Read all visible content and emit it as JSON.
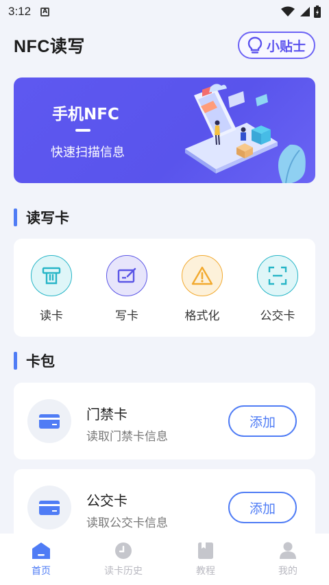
{
  "status_bar": {
    "time": "3:12"
  },
  "header": {
    "title": "NFC读写",
    "tips_label": "小贴士"
  },
  "banner": {
    "title": "手机NFC",
    "subtitle": "快速扫描信息"
  },
  "sections": {
    "read_write": "读写卡",
    "wallet": "卡包"
  },
  "tools": [
    {
      "label": "读卡",
      "icon": "card-reader-icon",
      "color": "#26b5c7",
      "bg": "#dff6f8"
    },
    {
      "label": "写卡",
      "icon": "write-card-icon",
      "color": "#5a55e6",
      "bg": "#e7e5fb"
    },
    {
      "label": "格式化",
      "icon": "warning-icon",
      "color": "#f2a92e",
      "bg": "#fdf1da"
    },
    {
      "label": "公交卡",
      "icon": "scan-icon",
      "color": "#26b5c7",
      "bg": "#dff6f8"
    }
  ],
  "cards": [
    {
      "name": "门禁卡",
      "desc": "读取门禁卡信息",
      "button": "添加"
    },
    {
      "name": "公交卡",
      "desc": "读取公交卡信息",
      "button": "添加"
    }
  ],
  "tabs": [
    {
      "label": "首页",
      "icon": "home-icon",
      "active": true
    },
    {
      "label": "读卡历史",
      "icon": "clock-icon",
      "active": false
    },
    {
      "label": "教程",
      "icon": "book-icon",
      "active": false
    },
    {
      "label": "我的",
      "icon": "user-icon",
      "active": false
    }
  ],
  "colors": {
    "accent": "#4f7cf5",
    "banner": "#5e58f0",
    "tips": "#5b52ee"
  }
}
